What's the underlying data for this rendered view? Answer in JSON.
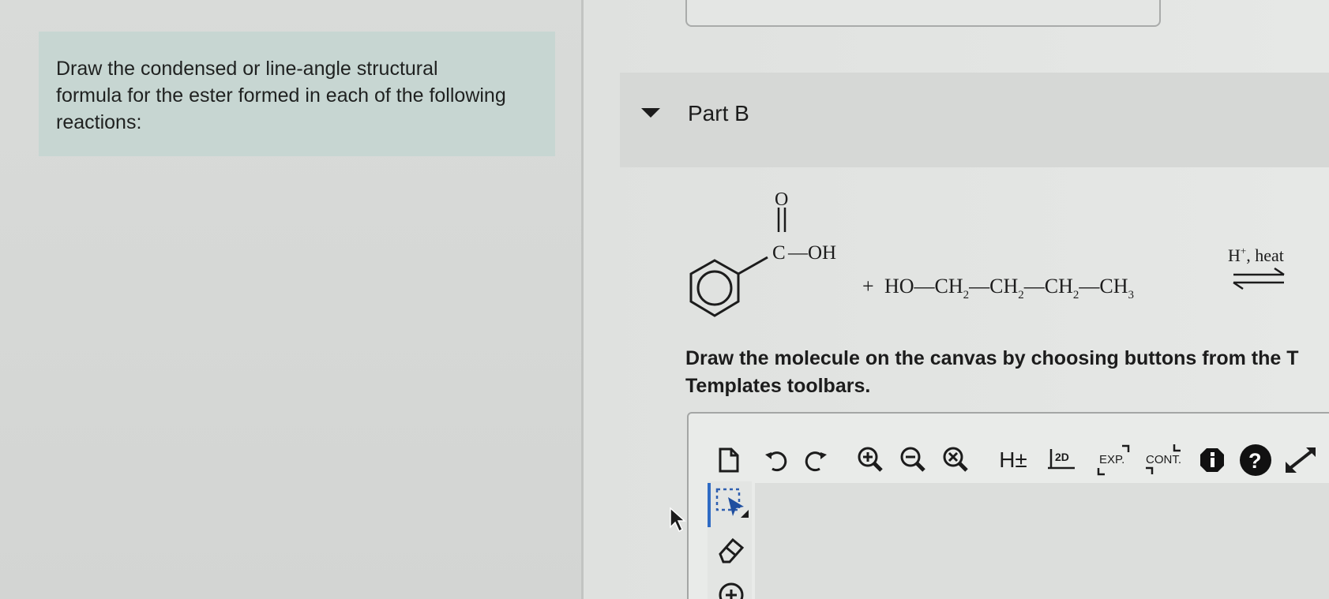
{
  "instructions": {
    "line1": "Draw the condensed or line-angle structural",
    "line2": "formula for the ester formed in each of the following",
    "line3": "reactions:"
  },
  "part": {
    "title": "Part B"
  },
  "reaction": {
    "carbonyl_o": "O",
    "carbon": "C",
    "dash_oh": "—OH",
    "plus": "+",
    "alcohol_parts": [
      "HO—CH",
      "2",
      "—CH",
      "2",
      "—CH",
      "2",
      "—CH",
      "3"
    ],
    "conditions": "H",
    "conditions_sup": "+",
    "conditions_rest": ", heat"
  },
  "prompt": {
    "line1": "Draw the molecule on the canvas by choosing buttons from the T",
    "line2": "Templates toolbars."
  },
  "toolbar": {
    "h_label": "H±",
    "twod_label": "2D",
    "exp_label": "EXP.",
    "cont_label": "CONT."
  }
}
